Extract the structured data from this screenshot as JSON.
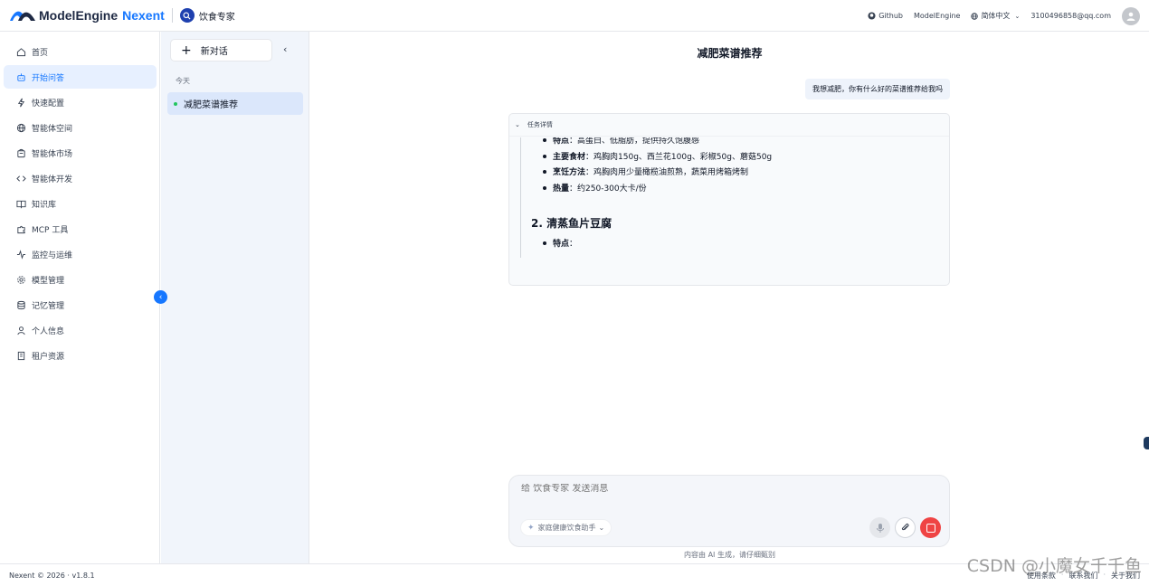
{
  "header": {
    "logo_text": "ModelEngine",
    "logo_sub": "Nexent",
    "agent_name": "饮食专家",
    "links": {
      "github": "Github",
      "modelengine": "ModelEngine",
      "language": "简体中文"
    },
    "user_email": "3100496858@qq.com"
  },
  "sidebar": {
    "items": [
      {
        "label": "首页",
        "icon": "home-icon",
        "active": false
      },
      {
        "label": "开始问答",
        "icon": "robot-icon",
        "active": true
      },
      {
        "label": "快速配置",
        "icon": "bolt-icon",
        "active": false
      },
      {
        "label": "智能体空间",
        "icon": "globe-icon",
        "active": false
      },
      {
        "label": "智能体市场",
        "icon": "store-icon",
        "active": false
      },
      {
        "label": "智能体开发",
        "icon": "code-icon",
        "active": false
      },
      {
        "label": "知识库",
        "icon": "book-icon",
        "active": false
      },
      {
        "label": "MCP 工具",
        "icon": "puzzle-icon",
        "active": false
      },
      {
        "label": "监控与运维",
        "icon": "pulse-icon",
        "active": false
      },
      {
        "label": "模型管理",
        "icon": "gear-icon",
        "active": false
      },
      {
        "label": "记忆管理",
        "icon": "database-icon",
        "active": false
      },
      {
        "label": "个人信息",
        "icon": "user-icon",
        "active": false
      },
      {
        "label": "租户资源",
        "icon": "building-icon",
        "active": false
      }
    ]
  },
  "conversations": {
    "new_chat_label": "新对话",
    "group_label": "今天",
    "items": [
      {
        "title": "减肥菜谱推荐",
        "active": true
      }
    ]
  },
  "chat": {
    "title": "减肥菜谱推荐",
    "user_message": "我想减肥，你有什么好的菜谱推荐给我吗",
    "task_header": "任务详情",
    "task_lines": [
      {
        "key": "特点",
        "value": "：高蛋白、低脂肪，提供持久饱腹感"
      },
      {
        "key": "主要食材",
        "value": "：鸡胸肉150g、西兰花100g、彩椒50g、蘑菇50g"
      },
      {
        "key": "烹饪方法",
        "value": "：鸡胸肉用少量橄榄油煎熟，蔬菜用烤箱烤制"
      },
      {
        "key": "热量",
        "value": "：约250-300大卡/份"
      }
    ],
    "task_heading": "2. 清蒸鱼片豆腐",
    "task_last": {
      "key": "特点",
      "value": "："
    },
    "input_placeholder": "给 饮食专家 发送消息",
    "assistant_chip": "家庭健康饮食助手",
    "disclaimer": "内容由 AI 生成，请仔细甄别"
  },
  "footer": {
    "copyright": "Nexent © 2026 · v1.8.1",
    "links": [
      "使用条款",
      "联系我们",
      "关于我们"
    ]
  },
  "watermark": "CSDN @小魔女千千鱼",
  "colors": {
    "accent": "#1677ff",
    "active_bg": "#e7f0ff",
    "stop": "#ef4444"
  }
}
